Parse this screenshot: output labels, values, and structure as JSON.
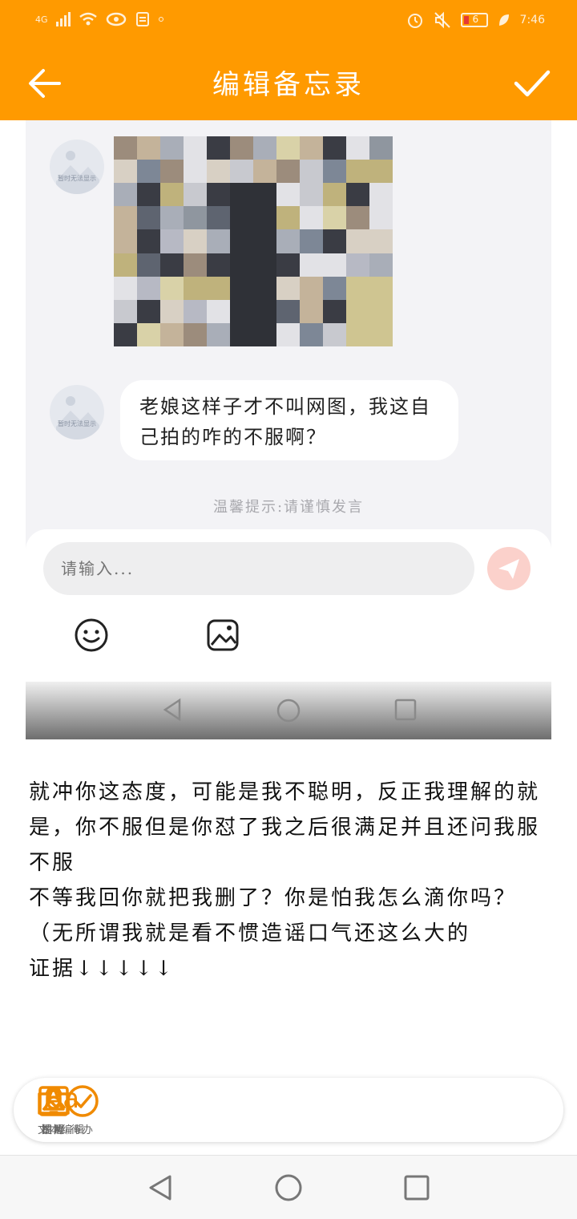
{
  "status_bar": {
    "network": "4G",
    "time": "7:46",
    "battery_level": "6"
  },
  "header": {
    "title": "编辑备忘录"
  },
  "chat": {
    "avatar_label": "暂时无法显示",
    "message": "老娘这样子才不叫网图，我这自己拍的咋的不服啊？",
    "tip": "温馨提示:请谨慎发言",
    "input_placeholder": "请输入..."
  },
  "note": {
    "lines": [
      "就冲你这态度，可能是我不聪明，反正我理解的就是，你不服但是你怼了我之后很满足并且还问我服不服",
      "不等我回你就把我删了？你是怕我怎么滴你吗？（无所谓我就是看不惯造谣口气还这么大的",
      "证据↓↓↓↓↓"
    ]
  },
  "toolbar": {
    "todo": "待办",
    "remind": "提醒",
    "image": "图片",
    "photo": "拍照",
    "text_edit_icon": "Aa",
    "text_edit": "文本编辑"
  },
  "colors": {
    "accent": "#ff9a00",
    "icon": "#f08a00"
  }
}
